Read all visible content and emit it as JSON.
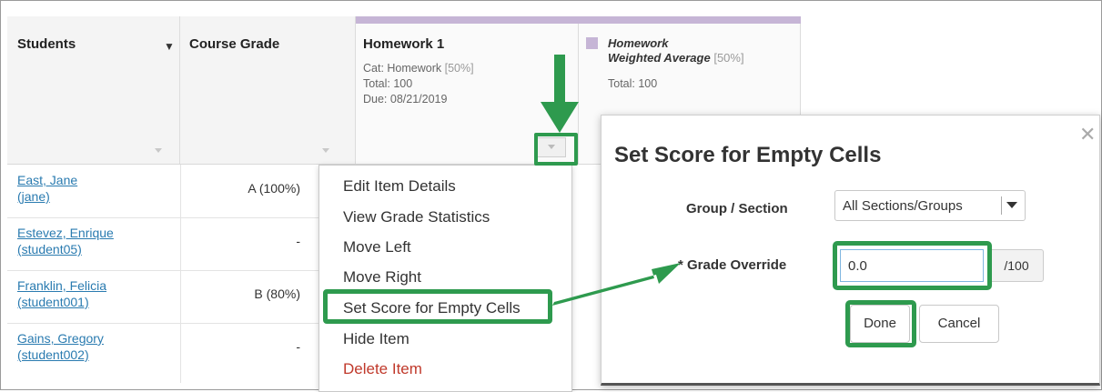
{
  "columns": {
    "students": {
      "title": "Students"
    },
    "course_grade": {
      "title": "Course Grade"
    },
    "homework1": {
      "title": "Homework 1",
      "category": "Cat: Homework",
      "category_pct": "[50%]",
      "total": "Total: 100",
      "due": "Due: 08/21/2019"
    },
    "weighted": {
      "title_line1": "Homework",
      "title_line2": "Weighted Average",
      "pct": "[50%]",
      "total": "Total: 100"
    }
  },
  "rows": [
    {
      "name": "East, Jane",
      "user": "(jane)",
      "grade": "A (100%)"
    },
    {
      "name": "Estevez, Enrique",
      "user": "(student05)",
      "grade": "-"
    },
    {
      "name": "Franklin, Felicia",
      "user": "(student001)",
      "grade": "B (80%)"
    },
    {
      "name": "Gains, Gregory",
      "user": "(student002)",
      "grade": "-"
    }
  ],
  "menu": {
    "items": [
      "Edit Item Details",
      "View Grade Statistics",
      "Move Left",
      "Move Right",
      "Set Score for Empty Cells",
      "Hide Item",
      "Delete Item"
    ]
  },
  "dialog": {
    "title": "Set Score for Empty Cells",
    "group_label": "Group / Section",
    "group_value": "All Sections/Groups",
    "override_label": "* Grade Override",
    "override_value": "0.0",
    "override_suffix": "/100",
    "done_label": "Done",
    "cancel_label": "Cancel"
  },
  "colors": {
    "highlight": "#2e9a4e",
    "link": "#2a7bb0",
    "category_band": "#c6b5d6",
    "delete": "#c0392b"
  },
  "icons": [
    "sort-caret-icon",
    "column-menu-icon",
    "close-icon",
    "chevron-down-icon",
    "arrow-icon"
  ]
}
